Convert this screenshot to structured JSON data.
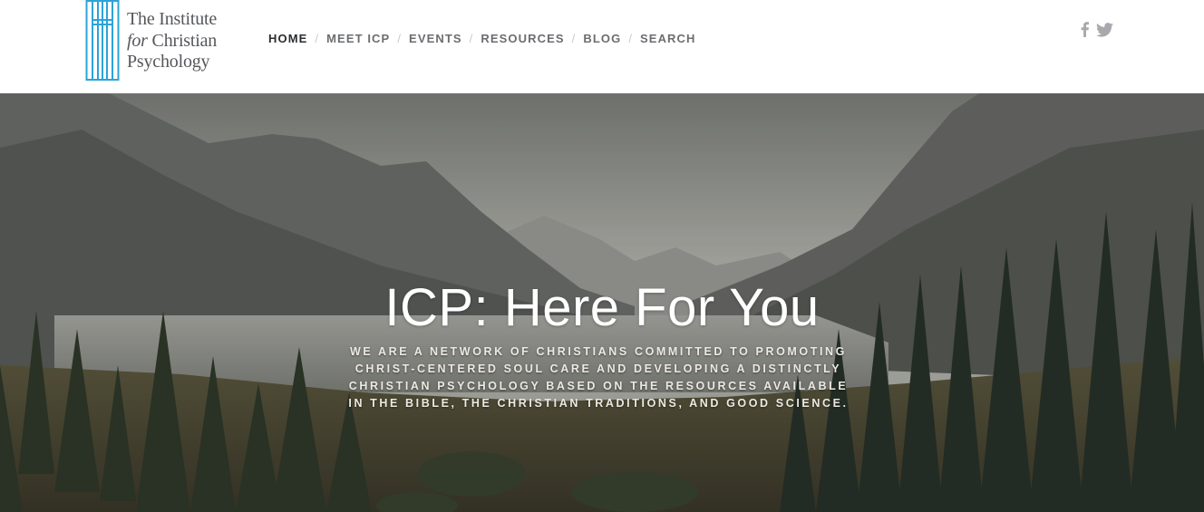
{
  "logo": {
    "line1": "The Institute",
    "line2_italic": "for",
    "line2_rest": " Christian",
    "line3": "Psychology",
    "color": "#2da3d9"
  },
  "nav": {
    "items": [
      {
        "label": "HOME",
        "active": true
      },
      {
        "label": "MEET ICP"
      },
      {
        "label": "EVENTS"
      },
      {
        "label": "RESOURCES"
      },
      {
        "label": "BLOG"
      },
      {
        "label": "SEARCH"
      }
    ],
    "separator": "/"
  },
  "social": {
    "facebook_glyph": "f",
    "twitter_icon": "twitter-icon",
    "color": "#a7a9ac"
  },
  "hero": {
    "title": "ICP: Here For You",
    "subtitle": "WE ARE A NETWORK OF CHRISTIANS COMMITTED TO PROMOTING CHRIST-CENTERED SOUL CARE AND DEVELOPING A DISTINCTLY CHRISTIAN PSYCHOLOGY BASED ON THE RESOURCES AVAILABLE IN THE BIBLE, THE CHRISTIAN TRADITIONS, AND GOOD SCIENCE."
  }
}
